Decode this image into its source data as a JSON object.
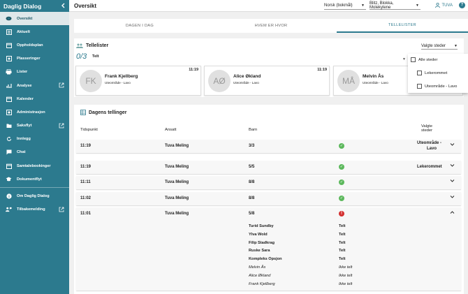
{
  "sidebar": {
    "title": "Daglig Dialog",
    "items": [
      {
        "label": "Oversikt",
        "icon": "eye-icon"
      },
      {
        "label": "Aktuelt",
        "icon": "grid-icon"
      },
      {
        "label": "Oppholdsplan",
        "icon": "calendar-icon"
      },
      {
        "label": "Plasseringer",
        "icon": "location-icon"
      },
      {
        "label": "Lister",
        "icon": "printer-icon"
      },
      {
        "label": "Analyse",
        "icon": "chart-icon"
      },
      {
        "label": "Kalender",
        "icon": "calendar-icon"
      },
      {
        "label": "Administrasjon",
        "icon": "settings-icon"
      },
      {
        "label": "Saksflyt",
        "icon": "folder-icon"
      },
      {
        "label": "Innlegg",
        "icon": "refresh-icon"
      },
      {
        "label": "Chat",
        "icon": "chat-icon"
      },
      {
        "label": "Samtalebookinger",
        "icon": "calendar-icon"
      },
      {
        "label": "Dokumentflyt",
        "icon": "hat-icon"
      },
      {
        "label": "Om Daglig Dialog",
        "icon": "info-icon"
      },
      {
        "label": "Tilbakemelding",
        "icon": "feedback-icon"
      }
    ]
  },
  "topbar": {
    "title": "Oversikt",
    "language": "Norsk (bokmål)",
    "departments": "Blitz, Blokka, Molekylene",
    "user": "TUVA",
    "help": "?"
  },
  "tabs": [
    "DAGEN I DAG",
    "HVEM ER HVOR",
    "TELLELISTER"
  ],
  "tellelister": {
    "title": "Tellelister",
    "count": "0/3",
    "count_label": "Telt",
    "selected_places_label": "Valgte steder",
    "people": [
      {
        "initials": "FK",
        "name": "Frank Kjellberg",
        "location": "Uteområde - Lavo",
        "time": "11:19"
      },
      {
        "initials": "AØ",
        "name": "Alice Økland",
        "location": "Uteområde - Lavo",
        "time": "11:19"
      },
      {
        "initials": "MÅ",
        "name": "Melvin Ås",
        "location": "Uteområde - Lavo",
        "time": "11:19"
      }
    ],
    "places": [
      "Alle steder",
      "Lekerommet",
      "Uteområde - Lavo"
    ]
  },
  "dagens": {
    "title": "Dagens tellinger",
    "headers": {
      "time": "Tidspunkt",
      "employee": "Ansatt",
      "children": "Barn",
      "places_line1": "Valgte",
      "places_line2": "steder"
    },
    "rows": [
      {
        "time": "11:19",
        "employee": "Tuva Meling",
        "children": "3/3",
        "status": "ok",
        "place1": "Uteområde -",
        "place2": "Lavo"
      },
      {
        "time": "11:19",
        "employee": "Tuva Meling",
        "children": "5/5",
        "status": "ok",
        "place1": "Lekerommet",
        "place2": ""
      },
      {
        "time": "11:11",
        "employee": "Tuva Meling",
        "children": "8/8",
        "status": "ok",
        "place1": "",
        "place2": ""
      },
      {
        "time": "11:02",
        "employee": "Tuva Meling",
        "children": "8/8",
        "status": "ok",
        "place1": "",
        "place2": ""
      },
      {
        "time": "11:01",
        "employee": "Tuva Meling",
        "children": "5/8",
        "status": "error",
        "place1": "",
        "place2": ""
      }
    ],
    "expanded": [
      {
        "name": "Turid Sundby",
        "status": "Telt",
        "counted": true
      },
      {
        "name": "Ylva Wold",
        "status": "Telt",
        "counted": true
      },
      {
        "name": "Filip Stadkrag",
        "status": "Telt",
        "counted": true
      },
      {
        "name": "Ruske Sara",
        "status": "Telt",
        "counted": true
      },
      {
        "name": "Kompleks Opsjon",
        "status": "Telt",
        "counted": true
      },
      {
        "name": "Melvin Ås",
        "status": "Ikke telt",
        "counted": false
      },
      {
        "name": "Alice Økland",
        "status": "Ikke telt",
        "counted": false
      },
      {
        "name": "Frank Kjellberg",
        "status": "Ikke telt",
        "counted": false
      }
    ]
  }
}
